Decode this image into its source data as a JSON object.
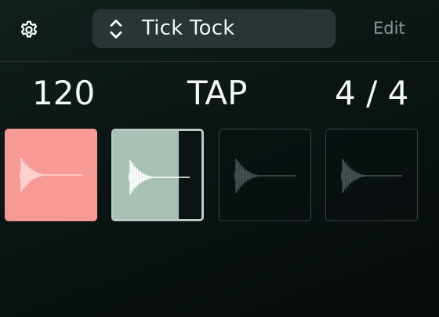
{
  "header": {
    "settings_icon": "gear-icon",
    "preset": {
      "icon": "up-down-chevrons-icon",
      "name": "Tick Tock"
    },
    "edit_label": "Edit"
  },
  "transport": {
    "tempo": "120",
    "tap_label": "TAP",
    "time_signature": "4 / 4"
  },
  "beats": [
    {
      "index": 1,
      "state": "accent",
      "color": "#f79a96",
      "icon": "waveform-icon"
    },
    {
      "index": 2,
      "state": "playing",
      "color": "#a7c2b5",
      "progress": 0.74,
      "icon": "waveform-icon"
    },
    {
      "index": 3,
      "state": "inactive",
      "icon": "waveform-icon"
    },
    {
      "index": 4,
      "state": "inactive",
      "icon": "waveform-icon"
    }
  ],
  "colors": {
    "accent_pad": "#f79a96",
    "playing_pad": "#a7c2b5",
    "preset_bg": "#2a3437",
    "muted_text": "#8e9598"
  }
}
